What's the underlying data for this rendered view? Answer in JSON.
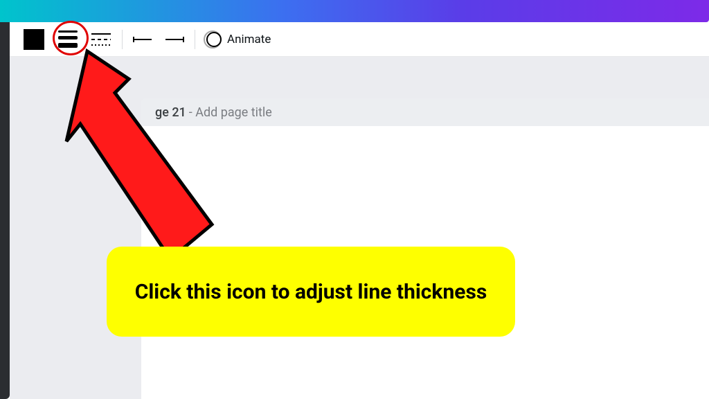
{
  "toolbar": {
    "color_swatch": "#000000",
    "animate_label": "Animate"
  },
  "page": {
    "label_partial": "ge 21",
    "subtitle": "- Add page title"
  },
  "annotation": {
    "callout_text": "Click this icon to adjust line thickness"
  }
}
